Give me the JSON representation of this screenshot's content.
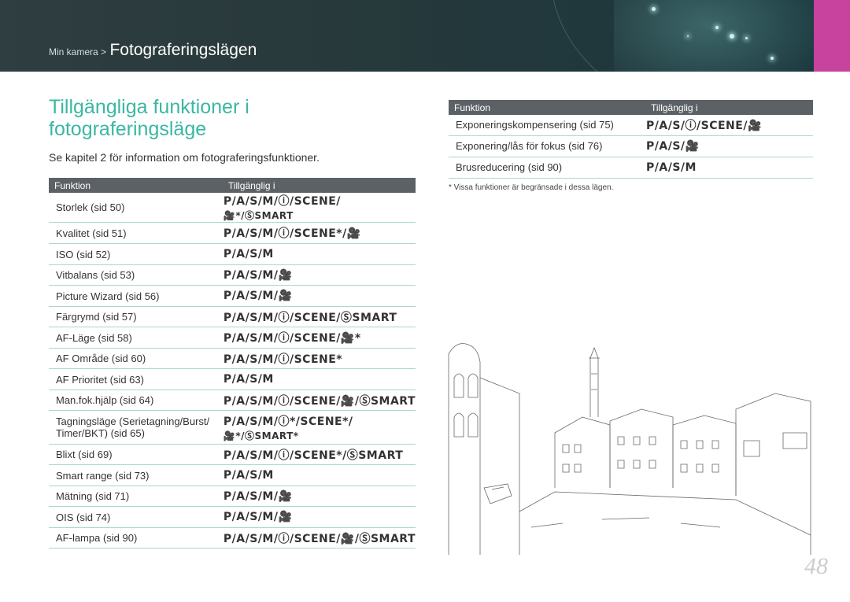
{
  "header": {
    "breadcrumb_parent": "Min kamera >",
    "breadcrumb_current": "Fotograferingslägen",
    "accent_color": "#c8439d"
  },
  "title": "Tillgängliga funktioner i fotograferingsläge",
  "intro": "Se kapitel 2 för information om fotograferingsfunktioner.",
  "table_headers": {
    "function": "Funktion",
    "available": "Tillgänglig i"
  },
  "left_table": [
    {
      "function": "Storlek (sid 50)",
      "modes": "P/A/S/M/ⓘ/SCENE/",
      "modes2": "🎥*/ⓈSMART"
    },
    {
      "function": "Kvalitet (sid 51)",
      "modes": "P/A/S/M/ⓘ/SCENE*/🎥"
    },
    {
      "function": "ISO (sid 52)",
      "modes": "P/A/S/M"
    },
    {
      "function": "Vitbalans (sid 53)",
      "modes": "P/A/S/M/🎥"
    },
    {
      "function": "Picture Wizard (sid 56)",
      "modes": "P/A/S/M/🎥"
    },
    {
      "function": "Färgrymd (sid 57)",
      "modes": "P/A/S/M/ⓘ/SCENE/ⓈSMART"
    },
    {
      "function": "AF-Läge (sid 58)",
      "modes": "P/A/S/M/ⓘ/SCENE/🎥*"
    },
    {
      "function": "AF Område (sid 60)",
      "modes": "P/A/S/M/ⓘ/SCENE*"
    },
    {
      "function": "AF Prioritet (sid 63)",
      "modes": "P/A/S/M"
    },
    {
      "function": "Man.fok.hjälp (sid 64)",
      "modes": "P/A/S/M/ⓘ/SCENE/🎥/ⓈSMART"
    },
    {
      "function": "Tagningsläge (Serietagning/Burst/",
      "function2": "Timer/BKT) (sid 65)",
      "modes": "P/A/S/M/ⓘ*/SCENE*/",
      "modes2": "🎥*/ⓈSMART*"
    },
    {
      "function": "Blixt (sid 69)",
      "modes": "P/A/S/M/ⓘ/SCENE*/ⓈSMART"
    },
    {
      "function": "Smart range (sid 73)",
      "modes": "P/A/S/M"
    },
    {
      "function": "Mätning (sid 71)",
      "modes": "P/A/S/M/🎥"
    },
    {
      "function": "OIS (sid 74)",
      "modes": "P/A/S/M/🎥"
    },
    {
      "function": "AF-lampa (sid 90)",
      "modes": "P/A/S/M/ⓘ/SCENE/🎥/ⓈSMART"
    }
  ],
  "right_table": [
    {
      "function": "Exponeringskompensering (sid 75)",
      "modes": "P/A/S/ⓘ/SCENE/🎥"
    },
    {
      "function": "Exponering/lås för fokus (sid 76)",
      "modes": "P/A/S/🎥"
    },
    {
      "function": "Brusreducering (sid 90)",
      "modes": "P/A/S/M"
    }
  ],
  "note": "* Vissa funktioner är begränsade i dessa lägen.",
  "page_number": "48"
}
